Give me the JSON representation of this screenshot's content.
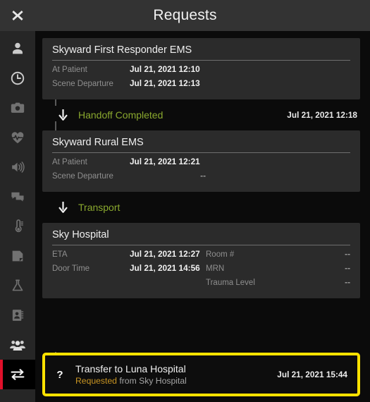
{
  "header": {
    "title": "Requests",
    "close_icon": "close-x-icon"
  },
  "sidebar": {
    "items": [
      {
        "name": "patient",
        "icon": "person-icon",
        "state": "bright"
      },
      {
        "name": "timeline",
        "icon": "clock-icon",
        "state": "bright"
      },
      {
        "name": "photos",
        "icon": "camera-icon",
        "state": "dim"
      },
      {
        "name": "vitals",
        "icon": "heartbeat-icon",
        "state": "dim"
      },
      {
        "name": "audio",
        "icon": "speaker-icon",
        "state": "dim"
      },
      {
        "name": "messages",
        "icon": "chat-bubbles-icon",
        "state": "dim"
      },
      {
        "name": "temperature",
        "icon": "thermometer-icon",
        "state": "dim"
      },
      {
        "name": "notes",
        "icon": "note-page-icon",
        "state": "dim"
      },
      {
        "name": "labs",
        "icon": "flask-icon",
        "state": "dim"
      },
      {
        "name": "contacts",
        "icon": "contact-book-icon",
        "state": "dim"
      },
      {
        "name": "team",
        "icon": "people-group-icon",
        "state": "bright"
      },
      {
        "name": "transfers",
        "icon": "transfer-arrows-icon",
        "state": "active"
      }
    ]
  },
  "timeline": {
    "cards": [
      {
        "title": "Skyward First Responder EMS",
        "col1": [
          {
            "label": "At Patient",
            "value": "Jul 21, 2021 12:10",
            "dash": false
          },
          {
            "label": "Scene Departure",
            "value": "Jul 21, 2021 12:13",
            "dash": false
          }
        ],
        "col2": []
      },
      {
        "title": "Skyward Rural EMS",
        "col1": [
          {
            "label": "At Patient",
            "value": "Jul 21, 2021 12:21",
            "dash": false
          },
          {
            "label": "Scene Departure",
            "value": "--",
            "dash": true
          }
        ],
        "col2": []
      },
      {
        "title": "Sky Hospital",
        "col1": [
          {
            "label": "ETA",
            "value": "Jul 21, 2021 12:27",
            "dash": false
          },
          {
            "label": "Door Time",
            "value": "Jul 21, 2021 14:56",
            "dash": false
          }
        ],
        "col2": [
          {
            "label": "Room #",
            "value": "--",
            "dash": true
          },
          {
            "label": "MRN",
            "value": "--",
            "dash": true
          },
          {
            "label": "Trauma Level",
            "value": "--",
            "dash": true
          }
        ]
      }
    ],
    "events": [
      {
        "icon": "down-arrow-icon",
        "label": "Handoff Completed",
        "time": "Jul 21, 2021 12:18"
      },
      {
        "icon": "down-arrow-icon",
        "label": "Transport",
        "time": ""
      }
    ]
  },
  "request": {
    "icon": "question-mark-icon",
    "title": "Transfer to Luna Hospital",
    "status": "Requested",
    "from": "from Sky Hospital",
    "time": "Jul 21, 2021 15:44"
  },
  "colors": {
    "accent_red": "#e0102a",
    "highlight_yellow": "#ffe200",
    "event_green": "#8aa82e",
    "status_amber": "#c89422",
    "card_bg": "#2b2b2b",
    "page_bg": "#0b0b0b",
    "header_bg": "#333333"
  }
}
